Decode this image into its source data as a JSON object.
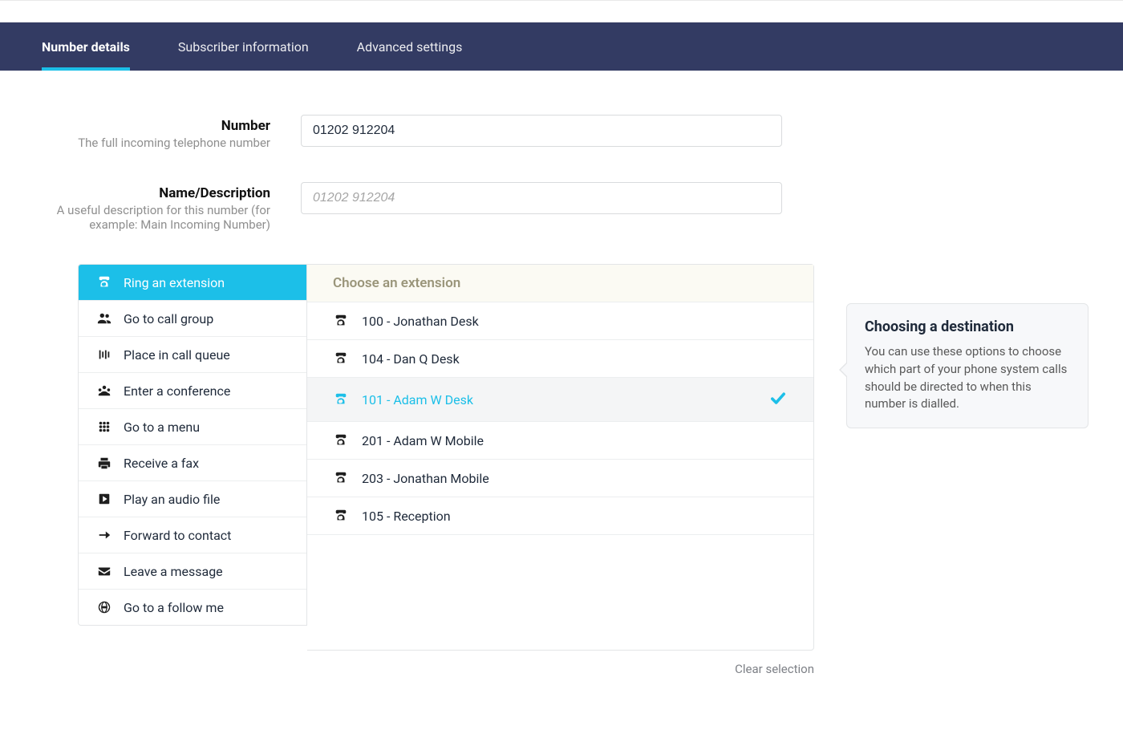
{
  "nav": {
    "tabs": [
      {
        "label": "Number details",
        "active": true
      },
      {
        "label": "Subscriber information",
        "active": false
      },
      {
        "label": "Advanced settings",
        "active": false
      }
    ]
  },
  "fields": {
    "number": {
      "label": "Number",
      "help": "The full incoming telephone number",
      "value": "01202 912204"
    },
    "name": {
      "label": "Name/Description",
      "help": "A useful description for this number (for example: Main Incoming Number)",
      "placeholder": "01202 912204",
      "value": ""
    }
  },
  "destinations": [
    {
      "label": "Ring an extension",
      "icon": "phone",
      "selected": true
    },
    {
      "label": "Go to call group",
      "icon": "group",
      "selected": false
    },
    {
      "label": "Place in call queue",
      "icon": "queue",
      "selected": false
    },
    {
      "label": "Enter a conference",
      "icon": "conference",
      "selected": false
    },
    {
      "label": "Go to a menu",
      "icon": "grid",
      "selected": false
    },
    {
      "label": "Receive a fax",
      "icon": "fax",
      "selected": false
    },
    {
      "label": "Play an audio file",
      "icon": "play",
      "selected": false
    },
    {
      "label": "Forward to contact",
      "icon": "arrow-right",
      "selected": false
    },
    {
      "label": "Leave a message",
      "icon": "envelope",
      "selected": false
    },
    {
      "label": "Go to a follow me",
      "icon": "globe",
      "selected": false
    }
  ],
  "extensions_header": "Choose an extension",
  "extensions": [
    {
      "label": "100 - Jonathan Desk",
      "selected": false
    },
    {
      "label": "104 - Dan Q Desk",
      "selected": false
    },
    {
      "label": "101 - Adam W Desk",
      "selected": true
    },
    {
      "label": "201 - Adam W Mobile",
      "selected": false
    },
    {
      "label": "203 - Jonathan Mobile",
      "selected": false
    },
    {
      "label": "105 - Reception",
      "selected": false
    }
  ],
  "tooltip": {
    "title": "Choosing a destination",
    "body": "You can use these options to choose which part of your phone system calls should be directed to when this number is dialled."
  },
  "clear_selection_label": "Clear selection"
}
